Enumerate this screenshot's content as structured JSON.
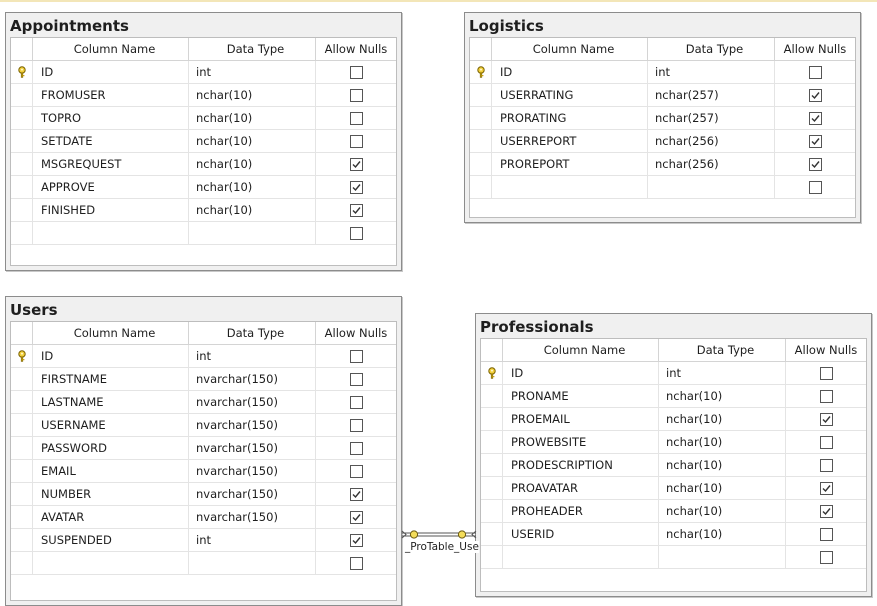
{
  "headers": {
    "column_name": "Column Name",
    "data_type": "Data Type",
    "allow_nulls": "Allow Nulls"
  },
  "relationship_label": "_ProTable_Use",
  "tables": {
    "appointments": {
      "title": "Appointments",
      "rows": [
        {
          "name": "ID",
          "type": "int",
          "nulls": false,
          "key": true
        },
        {
          "name": "FROMUSER",
          "type": "nchar(10)",
          "nulls": false
        },
        {
          "name": "TOPRO",
          "type": "nchar(10)",
          "nulls": false
        },
        {
          "name": "SETDATE",
          "type": "nchar(10)",
          "nulls": false
        },
        {
          "name": "MSGREQUEST",
          "type": "nchar(10)",
          "nulls": true
        },
        {
          "name": "APPROVE",
          "type": "nchar(10)",
          "nulls": true
        },
        {
          "name": "FINISHED",
          "type": "nchar(10)",
          "nulls": true
        },
        {
          "name": "",
          "type": "",
          "nulls": false
        }
      ]
    },
    "logistics": {
      "title": "Logistics",
      "rows": [
        {
          "name": "ID",
          "type": "int",
          "nulls": false,
          "key": true
        },
        {
          "name": "USERRATING",
          "type": "nchar(257)",
          "nulls": true
        },
        {
          "name": "PRORATING",
          "type": "nchar(257)",
          "nulls": true
        },
        {
          "name": "USERREPORT",
          "type": "nchar(256)",
          "nulls": true
        },
        {
          "name": "PROREPORT",
          "type": "nchar(256)",
          "nulls": true
        },
        {
          "name": "",
          "type": "",
          "nulls": false
        }
      ]
    },
    "users": {
      "title": "Users",
      "rows": [
        {
          "name": "ID",
          "type": "int",
          "nulls": false,
          "key": true
        },
        {
          "name": "FIRSTNAME",
          "type": "nvarchar(150)",
          "nulls": false
        },
        {
          "name": "LASTNAME",
          "type": "nvarchar(150)",
          "nulls": false
        },
        {
          "name": "USERNAME",
          "type": "nvarchar(150)",
          "nulls": false
        },
        {
          "name": "PASSWORD",
          "type": "nvarchar(150)",
          "nulls": false
        },
        {
          "name": "EMAIL",
          "type": "nvarchar(150)",
          "nulls": false
        },
        {
          "name": "NUMBER",
          "type": "nvarchar(150)",
          "nulls": true
        },
        {
          "name": "AVATAR",
          "type": "nvarchar(150)",
          "nulls": true
        },
        {
          "name": "SUSPENDED",
          "type": "int",
          "nulls": true
        },
        {
          "name": "",
          "type": "",
          "nulls": false
        }
      ]
    },
    "professionals": {
      "title": "Professionals",
      "rows": [
        {
          "name": "ID",
          "type": "int",
          "nulls": false,
          "key": true
        },
        {
          "name": "PRONAME",
          "type": "nchar(10)",
          "nulls": false
        },
        {
          "name": "PROEMAIL",
          "type": "nchar(10)",
          "nulls": true
        },
        {
          "name": "PROWEBSITE",
          "type": "nchar(10)",
          "nulls": false
        },
        {
          "name": "PRODESCRIPTION",
          "type": "nchar(10)",
          "nulls": false
        },
        {
          "name": "PROAVATAR",
          "type": "nchar(10)",
          "nulls": true
        },
        {
          "name": "PROHEADER",
          "type": "nchar(10)",
          "nulls": true
        },
        {
          "name": "USERID",
          "type": "nchar(10)",
          "nulls": false
        },
        {
          "name": "",
          "type": "",
          "nulls": false
        }
      ]
    }
  }
}
